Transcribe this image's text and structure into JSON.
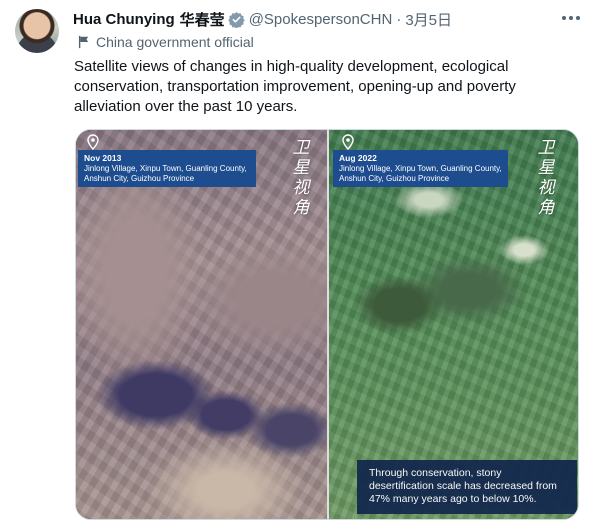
{
  "tweet": {
    "author_name": "Hua Chunying",
    "author_name_cn": "华春莹",
    "handle": "@SpokespersonCHN",
    "separator": "·",
    "date": "3月5日",
    "account_label": "China government official",
    "text": "Satellite views of changes in high-quality development, ecological conservation, transportation improvement, opening-up and poverty alleviation over the past 10 years."
  },
  "media": {
    "left_panel": {
      "date": "Nov 2013",
      "location": "Jinlong Village, Xinpu Town, Guanling County, Anshun City, Guizhou Province",
      "brand": "卫星视角"
    },
    "right_panel": {
      "date": "Aug 2022",
      "location": "Jinlong Village, Xinpu Town, Guanling County, Anshun City, Guizhou Province",
      "brand": "卫星视角"
    },
    "note": "Through conservation, stony desertification scale has decreased from 47% many years ago to below 10%."
  },
  "icons": {
    "verified": "verified-badge-icon",
    "more": "more-options-icon",
    "label": "flag-icon",
    "location": "location-pin-icon"
  },
  "colors": {
    "verified_badge": "#829aab",
    "caption_bg": "#1e4d8f",
    "note_bg": "#14294d",
    "secondary_text": "#536471"
  }
}
